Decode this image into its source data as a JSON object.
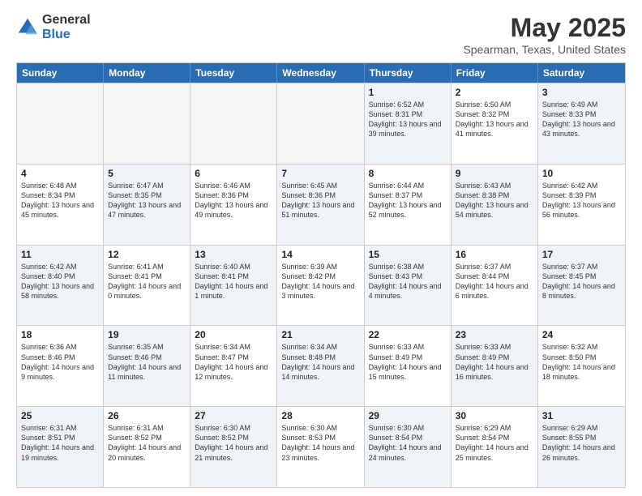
{
  "logo": {
    "general": "General",
    "blue": "Blue"
  },
  "header": {
    "month": "May 2025",
    "location": "Spearman, Texas, United States"
  },
  "weekdays": [
    "Sunday",
    "Monday",
    "Tuesday",
    "Wednesday",
    "Thursday",
    "Friday",
    "Saturday"
  ],
  "rows": [
    [
      {
        "day": "",
        "info": "",
        "empty": true
      },
      {
        "day": "",
        "info": "",
        "empty": true
      },
      {
        "day": "",
        "info": "",
        "empty": true
      },
      {
        "day": "",
        "info": "",
        "empty": true
      },
      {
        "day": "1",
        "info": "Sunrise: 6:52 AM\nSunset: 8:31 PM\nDaylight: 13 hours and 39 minutes.",
        "shaded": true
      },
      {
        "day": "2",
        "info": "Sunrise: 6:50 AM\nSunset: 8:32 PM\nDaylight: 13 hours and 41 minutes.",
        "shaded": false
      },
      {
        "day": "3",
        "info": "Sunrise: 6:49 AM\nSunset: 8:33 PM\nDaylight: 13 hours and 43 minutes.",
        "shaded": true
      }
    ],
    [
      {
        "day": "4",
        "info": "Sunrise: 6:48 AM\nSunset: 8:34 PM\nDaylight: 13 hours and 45 minutes.",
        "shaded": false
      },
      {
        "day": "5",
        "info": "Sunrise: 6:47 AM\nSunset: 8:35 PM\nDaylight: 13 hours and 47 minutes.",
        "shaded": true
      },
      {
        "day": "6",
        "info": "Sunrise: 6:46 AM\nSunset: 8:36 PM\nDaylight: 13 hours and 49 minutes.",
        "shaded": false
      },
      {
        "day": "7",
        "info": "Sunrise: 6:45 AM\nSunset: 8:36 PM\nDaylight: 13 hours and 51 minutes.",
        "shaded": true
      },
      {
        "day": "8",
        "info": "Sunrise: 6:44 AM\nSunset: 8:37 PM\nDaylight: 13 hours and 52 minutes.",
        "shaded": false
      },
      {
        "day": "9",
        "info": "Sunrise: 6:43 AM\nSunset: 8:38 PM\nDaylight: 13 hours and 54 minutes.",
        "shaded": true
      },
      {
        "day": "10",
        "info": "Sunrise: 6:42 AM\nSunset: 8:39 PM\nDaylight: 13 hours and 56 minutes.",
        "shaded": false
      }
    ],
    [
      {
        "day": "11",
        "info": "Sunrise: 6:42 AM\nSunset: 8:40 PM\nDaylight: 13 hours and 58 minutes.",
        "shaded": true
      },
      {
        "day": "12",
        "info": "Sunrise: 6:41 AM\nSunset: 8:41 PM\nDaylight: 14 hours and 0 minutes.",
        "shaded": false
      },
      {
        "day": "13",
        "info": "Sunrise: 6:40 AM\nSunset: 8:41 PM\nDaylight: 14 hours and 1 minute.",
        "shaded": true
      },
      {
        "day": "14",
        "info": "Sunrise: 6:39 AM\nSunset: 8:42 PM\nDaylight: 14 hours and 3 minutes.",
        "shaded": false
      },
      {
        "day": "15",
        "info": "Sunrise: 6:38 AM\nSunset: 8:43 PM\nDaylight: 14 hours and 4 minutes.",
        "shaded": true
      },
      {
        "day": "16",
        "info": "Sunrise: 6:37 AM\nSunset: 8:44 PM\nDaylight: 14 hours and 6 minutes.",
        "shaded": false
      },
      {
        "day": "17",
        "info": "Sunrise: 6:37 AM\nSunset: 8:45 PM\nDaylight: 14 hours and 8 minutes.",
        "shaded": true
      }
    ],
    [
      {
        "day": "18",
        "info": "Sunrise: 6:36 AM\nSunset: 8:46 PM\nDaylight: 14 hours and 9 minutes.",
        "shaded": false
      },
      {
        "day": "19",
        "info": "Sunrise: 6:35 AM\nSunset: 8:46 PM\nDaylight: 14 hours and 11 minutes.",
        "shaded": true
      },
      {
        "day": "20",
        "info": "Sunrise: 6:34 AM\nSunset: 8:47 PM\nDaylight: 14 hours and 12 minutes.",
        "shaded": false
      },
      {
        "day": "21",
        "info": "Sunrise: 6:34 AM\nSunset: 8:48 PM\nDaylight: 14 hours and 14 minutes.",
        "shaded": true
      },
      {
        "day": "22",
        "info": "Sunrise: 6:33 AM\nSunset: 8:49 PM\nDaylight: 14 hours and 15 minutes.",
        "shaded": false
      },
      {
        "day": "23",
        "info": "Sunrise: 6:33 AM\nSunset: 8:49 PM\nDaylight: 14 hours and 16 minutes.",
        "shaded": true
      },
      {
        "day": "24",
        "info": "Sunrise: 6:32 AM\nSunset: 8:50 PM\nDaylight: 14 hours and 18 minutes.",
        "shaded": false
      }
    ],
    [
      {
        "day": "25",
        "info": "Sunrise: 6:31 AM\nSunset: 8:51 PM\nDaylight: 14 hours and 19 minutes.",
        "shaded": true
      },
      {
        "day": "26",
        "info": "Sunrise: 6:31 AM\nSunset: 8:52 PM\nDaylight: 14 hours and 20 minutes.",
        "shaded": false
      },
      {
        "day": "27",
        "info": "Sunrise: 6:30 AM\nSunset: 8:52 PM\nDaylight: 14 hours and 21 minutes.",
        "shaded": true
      },
      {
        "day": "28",
        "info": "Sunrise: 6:30 AM\nSunset: 8:53 PM\nDaylight: 14 hours and 23 minutes.",
        "shaded": false
      },
      {
        "day": "29",
        "info": "Sunrise: 6:30 AM\nSunset: 8:54 PM\nDaylight: 14 hours and 24 minutes.",
        "shaded": true
      },
      {
        "day": "30",
        "info": "Sunrise: 6:29 AM\nSunset: 8:54 PM\nDaylight: 14 hours and 25 minutes.",
        "shaded": false
      },
      {
        "day": "31",
        "info": "Sunrise: 6:29 AM\nSunset: 8:55 PM\nDaylight: 14 hours and 26 minutes.",
        "shaded": true
      }
    ]
  ]
}
